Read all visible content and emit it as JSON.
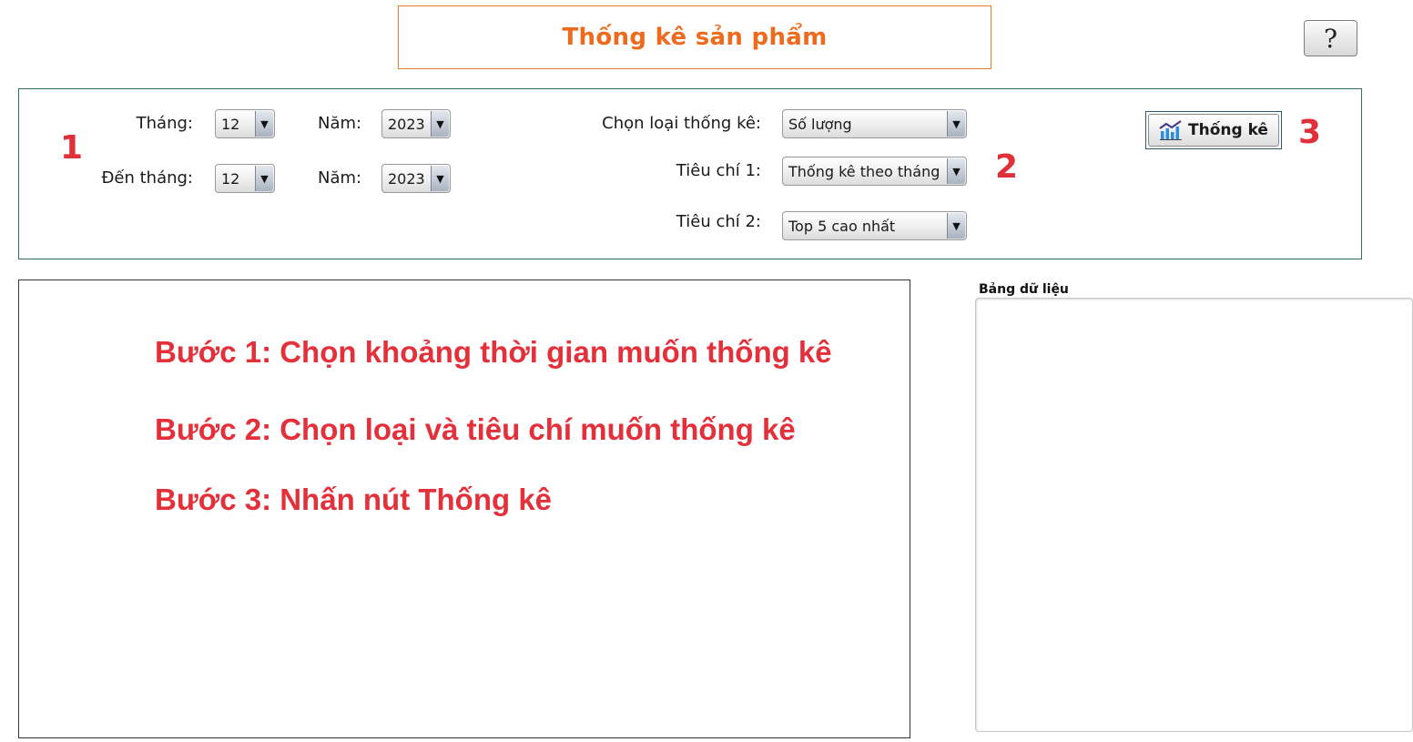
{
  "header": {
    "title": "Thống kê sản phẩm",
    "help_label": "?"
  },
  "filters": {
    "from_month_label": "Tháng:",
    "from_month_value": "12",
    "from_year_label": "Năm:",
    "from_year_value": "2023",
    "to_month_label": "Đến tháng:",
    "to_month_value": "12",
    "to_year_label": "Năm:",
    "to_year_value": "2023",
    "stat_type_label": "Chọn loại thống kê:",
    "stat_type_value": "Số lượng",
    "criteria1_label": "Tiêu chí 1:",
    "criteria1_value": "Thống kê theo tháng",
    "criteria2_label": "Tiêu chí 2:",
    "criteria2_value": "Top 5 cao nhất",
    "submit_label": "Thống kê",
    "submit_icon": "bar-chart-icon"
  },
  "annotations": {
    "step1": "1",
    "step2": "2",
    "step3": "3"
  },
  "instructions": [
    "Bước 1: Chọn khoảng thời gian muốn thống kê",
    "Bước 2: Chọn loại và tiêu chí muốn thống kê",
    "Bước 3: Nhấn nút Thống kê"
  ],
  "data_table": {
    "title": "Bảng dữ liệu"
  },
  "colors": {
    "title": "#ee6a1c",
    "annotation": "#e0303a",
    "panel_border": "#2f6f5b"
  }
}
